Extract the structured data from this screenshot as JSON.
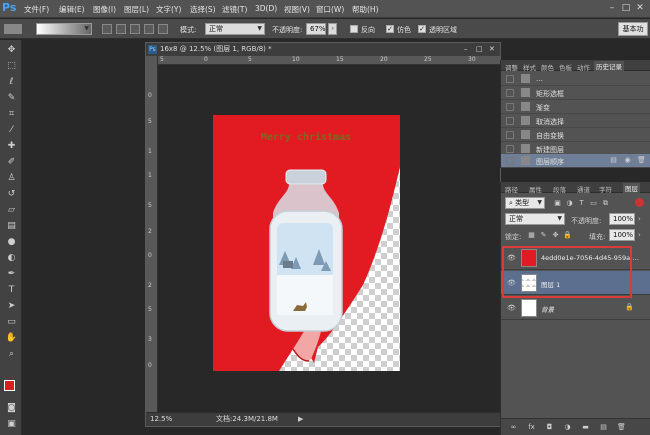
{
  "app": {
    "logo": "Ps"
  },
  "menu": [
    "文件(F)",
    "编辑(E)",
    "图像(I)",
    "图层(L)",
    "文字(Y)",
    "选择(S)",
    "滤镜(T)",
    "3D(D)",
    "视图(V)",
    "窗口(W)",
    "帮助(H)"
  ],
  "window_controls": [
    "–",
    "□",
    "✕"
  ],
  "options": {
    "mode_label": "模式:",
    "mode_value": "正常",
    "opacity_label": "不透明度:",
    "opacity_value": "67%",
    "reverse_label": "反向",
    "dither_label": "仿色",
    "transparency_label": "透明区域",
    "reverse_checked": false,
    "dither_checked": true,
    "transparency_checked": true,
    "workspace": "基本功"
  },
  "document": {
    "title": "16x8 @ 12.5% (图层 1, RGB/8) *",
    "title_controls": [
      "–",
      "□",
      "✕"
    ],
    "ruler_top": [
      "5",
      "0",
      "5",
      "10",
      "15",
      "20",
      "25",
      "30"
    ],
    "ruler_left": [
      "0",
      "5",
      "1",
      "1",
      "5",
      "2",
      "0",
      "2",
      "5",
      "3",
      "0"
    ],
    "zoom": "12.5%",
    "doc_size": "文档:24.3M/21.8M",
    "canvas_text": "Merry christmas",
    "sheet_color": "#e21b22",
    "text_color": "#7d6a1f"
  },
  "history_panel": {
    "tabs": [
      "调整",
      "样式",
      "颜色",
      "色板",
      "动作",
      "历史记录"
    ],
    "active_tab": "历史记录",
    "items": [
      {
        "label": "…",
        "selected": false
      },
      {
        "label": "矩形选框",
        "selected": false
      },
      {
        "label": "渐变",
        "selected": false
      },
      {
        "label": "取消选择",
        "selected": false
      },
      {
        "label": "自由变换",
        "selected": false
      },
      {
        "label": "新建图层",
        "selected": false
      },
      {
        "label": "图层顺序",
        "selected": true
      }
    ]
  },
  "layers_panel": {
    "tabs": [
      "路径",
      "属性",
      "段落",
      "通道",
      "字符",
      "图层"
    ],
    "active_tab": "图层",
    "filter_label": "类型",
    "blend_mode": "正常",
    "opacity_label": "不透明度:",
    "opacity_value": "100%",
    "lock_label": "锁定:",
    "fill_label": "填充:",
    "fill_value": "100%",
    "layers": [
      {
        "name": "4edd0e1e-7056-4d45-959a-…",
        "selected": false,
        "locked": false
      },
      {
        "name": "图层 1",
        "selected": true,
        "locked": false
      },
      {
        "name": "背景",
        "selected": false,
        "locked": true
      }
    ]
  },
  "colors": {
    "foreground": "#d61f1f",
    "background": "#e8e8e8",
    "highlight": "#d93a3a",
    "selection": "#5c6f8f"
  }
}
